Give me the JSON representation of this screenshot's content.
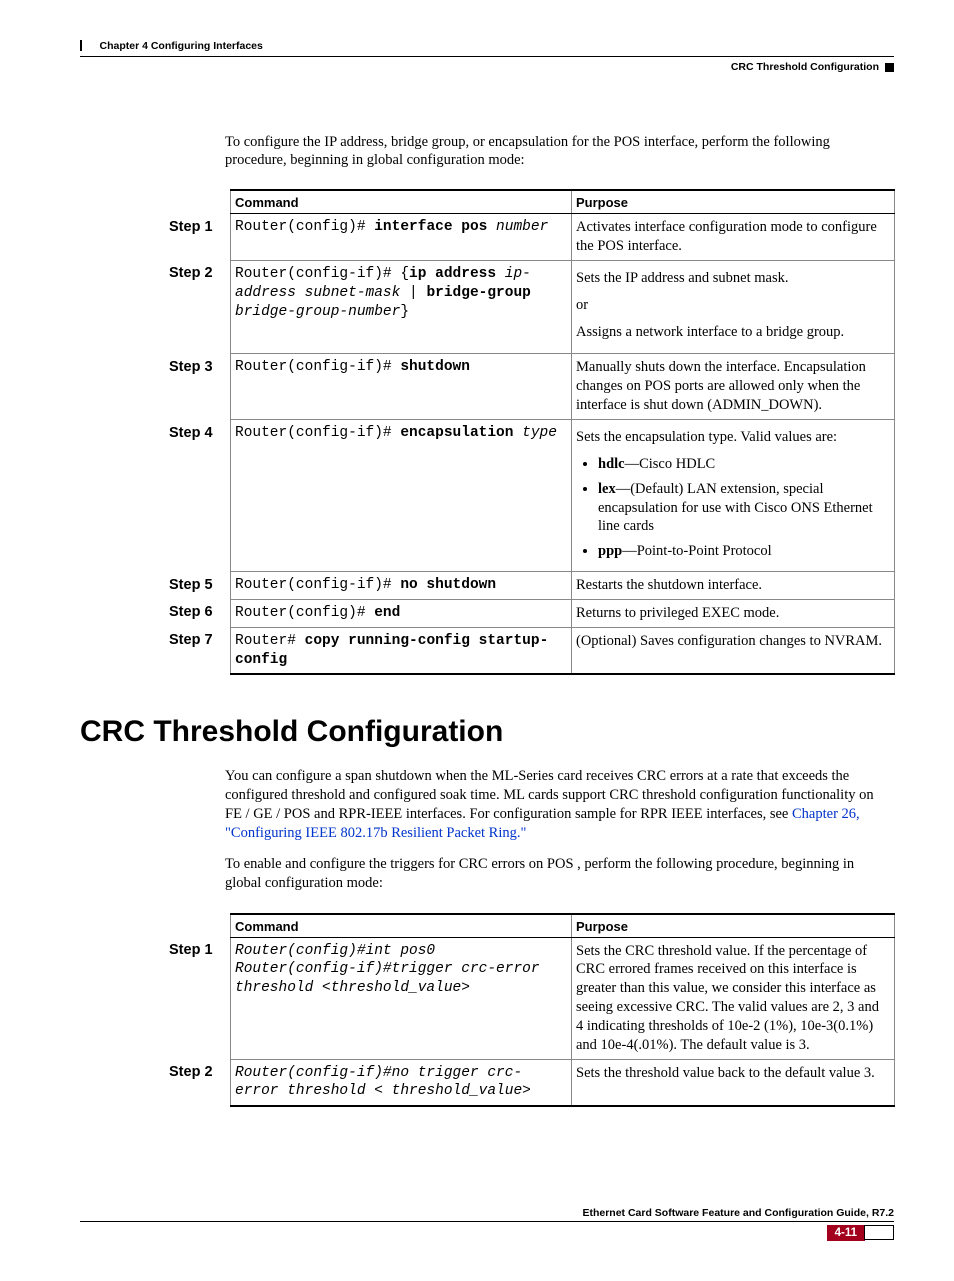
{
  "header": {
    "chapter": "Chapter 4    Configuring Interfaces",
    "section_right": "CRC Threshold Configuration"
  },
  "intro": "To configure the IP address, bridge group, or encapsulation for the POS interface, perform the following procedure, beginning in global configuration mode:",
  "table1": {
    "h_command": "Command",
    "h_purpose": "Purpose",
    "steps": {
      "s1": "Step 1",
      "s2": "Step 2",
      "s3": "Step 3",
      "s4": "Step 4",
      "s5": "Step 5",
      "s6": "Step 6",
      "s7": "Step 7"
    },
    "r1": {
      "c_pre": "Router(config)# ",
      "c_b1": "interface pos",
      "c_i1": " number",
      "p": "Activates interface configuration mode to configure the POS interface."
    },
    "r2": {
      "c_pre": "Router(config-if)# {",
      "c_b1": "ip address",
      "c_i1": " ip-address subnet-mask",
      "c_mid": " | ",
      "c_b2": "bridge-group",
      "c_i2": " bridge-group-number",
      "c_suf": "}",
      "p1": "Sets the IP address and subnet mask.",
      "p2": "or",
      "p3": "Assigns a network interface to a bridge group."
    },
    "r3": {
      "c_pre": "Router(config-if)# ",
      "c_b1": "shutdown",
      "p": "Manually shuts down the interface. Encapsulation changes on POS ports are allowed only when the interface is shut down (ADMIN_DOWN)."
    },
    "r4": {
      "c_pre": "Router(config-if)# ",
      "c_b1": "encapsulation",
      "c_i1": " type",
      "p_intro": "Sets the encapsulation type. Valid values are:",
      "li1_b": "hdlc",
      "li1_t": "—Cisco HDLC",
      "li2_b": "lex",
      "li2_t": "—(Default) LAN extension, special encapsulation for use with Cisco ONS Ethernet line cards",
      "li3_b": "ppp",
      "li3_t": "—Point-to-Point Protocol"
    },
    "r5": {
      "c_pre": "Router(config-if)# ",
      "c_b1": "no shutdown",
      "p": "Restarts the shutdown interface."
    },
    "r6": {
      "c_pre": "Router(config)# ",
      "c_b1": "end",
      "p": "Returns to privileged EXEC mode."
    },
    "r7": {
      "c_pre": "Router# ",
      "c_b1": "copy running-config startup-config",
      "p": "(Optional) Saves configuration changes to NVRAM."
    }
  },
  "section_title": "CRC Threshold Configuration",
  "para1_a": "You can configure a span shutdown when the ML-Series card receives CRC errors at a rate that exceeds the configured threshold and configured soak time. ML cards support CRC threshold configuration functionality on FE / GE / POS  and  RPR-IEEE interfaces.  For configuration sample for RPR IEEE interfaces, see ",
  "para1_link": "Chapter 26, \"Configuring IEEE 802.17b Resilient Packet Ring.\"",
  "para2": "To enable and configure the triggers for CRC errors  on POS , perform the following procedure, beginning in global configuration mode:",
  "table2": {
    "h_command": "Command",
    "h_purpose": "Purpose",
    "steps": {
      "s1": "Step 1",
      "s2": "Step 2"
    },
    "r1": {
      "c_l1": "Router(config)#int pos0",
      "c_l2": "Router(config-if)#trigger crc-error threshold <threshold_value>",
      "p": "Sets the CRC threshold value. If the percentage of CRC errored frames received on this interface is greater than this value, we consider this interface as seeing excessive CRC. The valid values are 2, 3 and 4 indicating thresholds of 10e-2 (1%), 10e-3(0.1%) and 10e-4(.01%). The default value is 3."
    },
    "r2": {
      "c": "Router(config-if)#no trigger crc-error threshold < threshold_value>",
      "p": "Sets the threshold value back to the default value 3."
    }
  },
  "footer": {
    "guide": "Ethernet Card Software Feature and Configuration Guide, R7.2",
    "page": "4-11"
  }
}
